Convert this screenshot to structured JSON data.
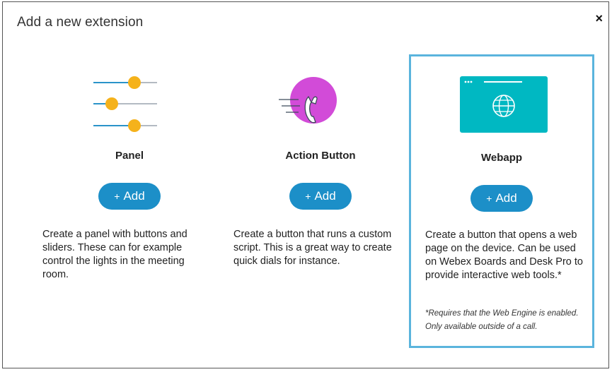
{
  "dialog": {
    "title": "Add a new extension",
    "close_icon": "×"
  },
  "cards": [
    {
      "title": "Panel",
      "add_label": "Add",
      "add_icon": "+",
      "description": "Create a panel with buttons and sliders. These can for example control the lights in the meeting room.",
      "icon": "sliders-icon"
    },
    {
      "title": "Action Button",
      "add_label": "Add",
      "add_icon": "+",
      "description": "Create a button that runs a custom script. This is a great way to create quick dials for instance.",
      "icon": "phone-icon"
    },
    {
      "title": "Webapp",
      "add_label": "Add",
      "add_icon": "+",
      "description": "Create a button that opens a web page on the device. Can be used on Webex Boards and Desk Pro to provide interactive web tools.*",
      "note": "*Requires that the Web Engine is enabled. Only available outside of a call.",
      "icon": "browser-globe-icon",
      "selected": true
    }
  ],
  "colors": {
    "accent_button": "#1c8fc8",
    "selected_border": "#5ab4dd",
    "slider_knob": "#f5b21b",
    "action_circle": "#d24bd8",
    "webapp_tile": "#00b8c2"
  }
}
